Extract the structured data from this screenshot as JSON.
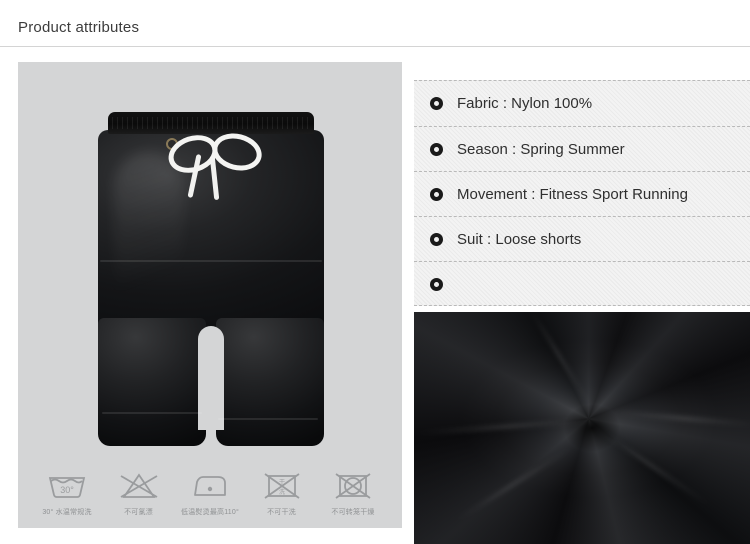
{
  "header": {
    "title": "Product attributes"
  },
  "product_image": {
    "alt_name": "black-nylon-shorts",
    "background_color": "#d4d5d6"
  },
  "care_instructions": [
    {
      "icon": "wash-30-icon",
      "label": "30° 水温常规洗"
    },
    {
      "icon": "do-not-bleach-icon",
      "label": "不可氯漂"
    },
    {
      "icon": "low-iron-110-icon",
      "label": "低温熨烫最高110°"
    },
    {
      "icon": "do-not-dryclean-icon",
      "label": "不可干洗"
    },
    {
      "icon": "do-not-tumble-dry-icon",
      "label": "不可转笼干燥"
    }
  ],
  "attributes": [
    {
      "label": "Fabric : Nylon 100%"
    },
    {
      "label": "Season : Spring Summer"
    },
    {
      "label": "Movement : Fitness Sport Running"
    },
    {
      "label": "Suit : Loose shorts"
    },
    {
      "label": ""
    }
  ],
  "fabric_closeup": {
    "alt_name": "black-fabric-swirl-closeup",
    "color": "#0a0a0b"
  },
  "colors": {
    "page_background": "#ffffff",
    "title_text": "#3c3c3c",
    "rule": "#d4d4d4",
    "panel_texture": "#f3f3f3",
    "dashed_border": "#b9b9b9",
    "bullet": "#1a1a1a",
    "attribute_text": "#2f2f2f",
    "care_icon": "#9a9c9e",
    "care_label_text": "#8f9193"
  }
}
